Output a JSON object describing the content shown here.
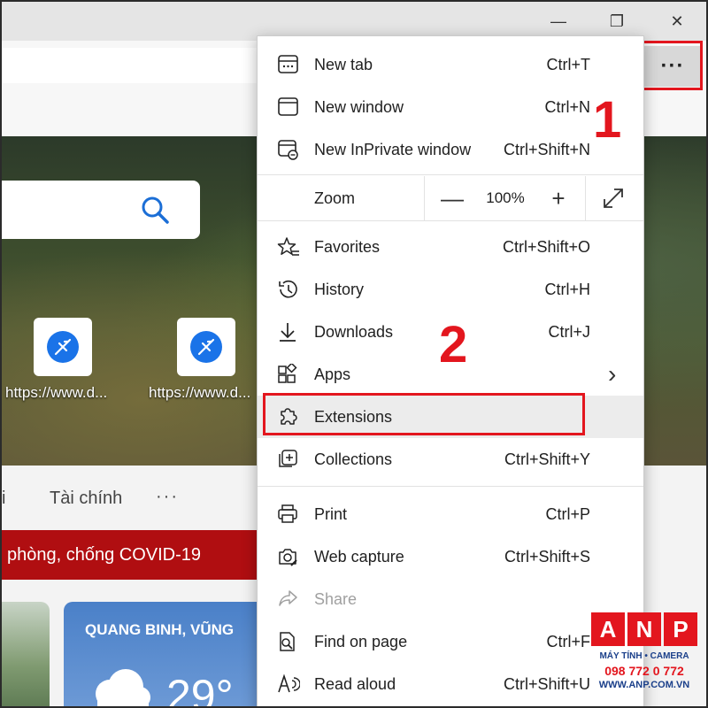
{
  "window": {
    "minimize_glyph": "—",
    "maximize_glyph": "❐",
    "close_glyph": "✕",
    "more_glyph": "···"
  },
  "page": {
    "tile1_label": "https://www.d...",
    "tile2_label": "https://www.d...",
    "nav_left": "i",
    "nav_finance": "Tài chính",
    "nav_more": "···",
    "covid_banner": "phòng, chống COVID-19",
    "weather_title": "QUANG BINH, VŨNG",
    "weather_temp": "29°"
  },
  "menu": {
    "new_tab": {
      "label": "New tab",
      "shortcut": "Ctrl+T"
    },
    "new_window": {
      "label": "New window",
      "shortcut": "Ctrl+N"
    },
    "new_inprivate": {
      "label": "New InPrivate window",
      "shortcut": "Ctrl+Shift+N"
    },
    "zoom": {
      "label": "Zoom",
      "minus": "—",
      "value": "100%",
      "plus": "+"
    },
    "favorites": {
      "label": "Favorites",
      "shortcut": "Ctrl+Shift+O"
    },
    "history": {
      "label": "History",
      "shortcut": "Ctrl+H"
    },
    "downloads": {
      "label": "Downloads",
      "shortcut": "Ctrl+J"
    },
    "apps": {
      "label": "Apps",
      "chevron": "›"
    },
    "extensions": {
      "label": "Extensions"
    },
    "collections": {
      "label": "Collections",
      "shortcut": "Ctrl+Shift+Y"
    },
    "print": {
      "label": "Print",
      "shortcut": "Ctrl+P"
    },
    "web_capture": {
      "label": "Web capture",
      "shortcut": "Ctrl+Shift+S"
    },
    "share": {
      "label": "Share"
    },
    "find_on_page": {
      "label": "Find on page",
      "shortcut": "Ctrl+F"
    },
    "read_aloud": {
      "label": "Read aloud",
      "shortcut": "Ctrl+Shift+U"
    }
  },
  "annotations": {
    "step1": "1",
    "step2": "2",
    "highlight_color": "#e3161e"
  },
  "watermark": {
    "letters": [
      "A",
      "N",
      "P"
    ],
    "line1": "MÁY TÍNH • CAMERA",
    "phone": "098 772 0 772",
    "url": "WWW.ANP.COM.VN"
  }
}
